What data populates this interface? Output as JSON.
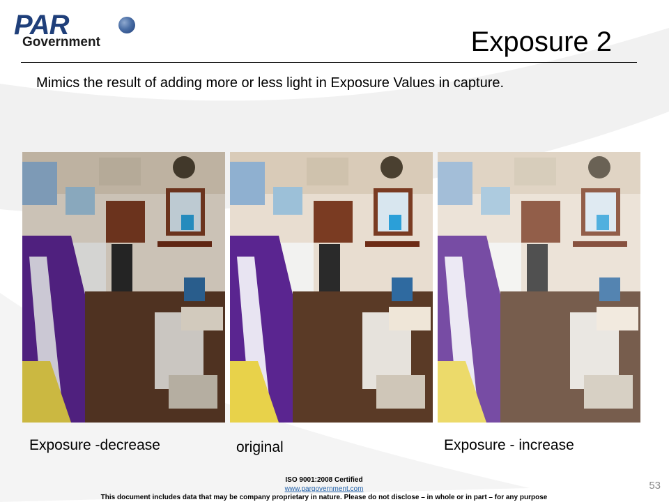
{
  "logo": {
    "brand": "PAR",
    "name": "Government"
  },
  "slide": {
    "title": "Exposure 2",
    "subtitle": "Mimics the result of adding more or less light in Exposure Values in capture."
  },
  "captions": {
    "decrease": "Exposure -decrease",
    "original": "original",
    "increase": "Exposure - increase"
  },
  "footer": {
    "certification": "ISO 9001:2008 Certified",
    "website": "www.pargovernment.com",
    "disclaimer": "This document includes data that may be company proprietary in nature. Please do not disclose – in whole or in part – for any purpose",
    "page_number": "53"
  },
  "colors": {
    "brand_blue": "#1f3f7a",
    "link_blue": "#1f5fa8",
    "page_number_gray": "#888888"
  }
}
